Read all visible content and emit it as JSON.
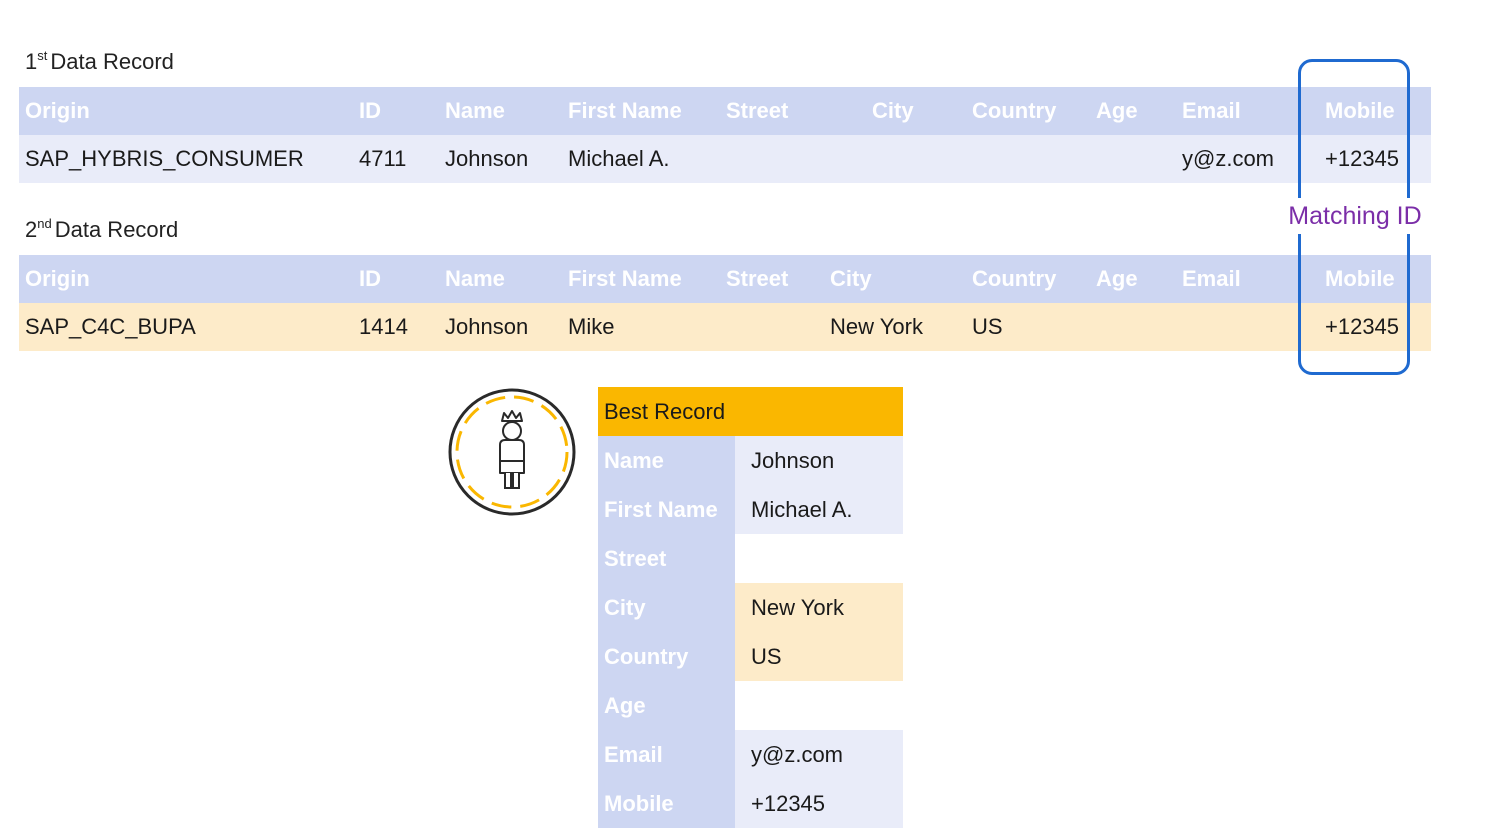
{
  "record1": {
    "caption_num": "1",
    "caption_sup": "st",
    "caption_text": "Data Record",
    "headers": [
      "Origin",
      "ID",
      "Name",
      "First Name",
      "Street",
      "City",
      "Country",
      "Age",
      "Email",
      "Mobile"
    ],
    "values": [
      "SAP_HYBRIS_CONSUMER",
      "4711",
      "Johnson",
      "Michael A.",
      "",
      "",
      "",
      "",
      "y@z.com",
      "+12345"
    ]
  },
  "record2": {
    "caption_num": "2",
    "caption_sup": "nd",
    "caption_text": "Data Record",
    "headers": [
      "Origin",
      "ID",
      "Name",
      "First Name",
      "Street",
      "City",
      "Country",
      "Age",
      "Email",
      "Mobile"
    ],
    "values": [
      "SAP_C4C_BUPA",
      "1414",
      "Johnson",
      "Mike",
      "",
      "New York",
      "US",
      "",
      "",
      "+12345"
    ]
  },
  "matching": {
    "label": "Matching ID"
  },
  "best_record": {
    "title": "Best Record",
    "rows": [
      {
        "label": "Name",
        "value": "Johnson",
        "source": "record1"
      },
      {
        "label": "First Name",
        "value": "Michael A.",
        "source": "record1"
      },
      {
        "label": "Street",
        "value": "",
        "source": "none"
      },
      {
        "label": "City",
        "value": "New York",
        "source": "record2"
      },
      {
        "label": "Country",
        "value": "US",
        "source": "record2"
      },
      {
        "label": "Age",
        "value": "",
        "source": "none"
      },
      {
        "label": "Email",
        "value": "y@z.com",
        "source": "record1"
      },
      {
        "label": "Mobile",
        "value": "+12345",
        "source": "record1"
      }
    ]
  },
  "icons": {
    "best_record_icon": "crowned-person-icon"
  },
  "colors": {
    "header_bg": "#cdd6f2",
    "record1_row_bg": "#e9ecf9",
    "record2_row_bg": "#fdebc9",
    "best_title_bg": "#fab700",
    "matching_box": "#1f6ad0",
    "matching_text": "#7b2ea8"
  }
}
